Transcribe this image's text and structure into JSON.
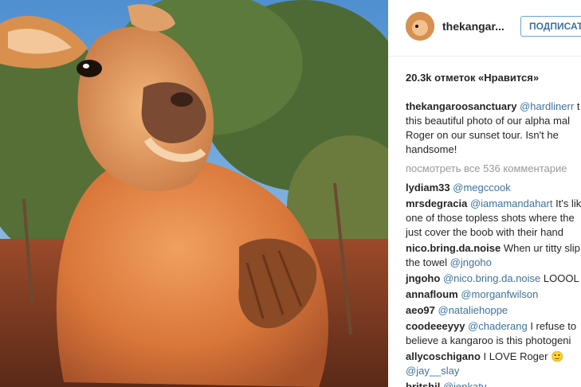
{
  "post": {
    "username": "thekangar...",
    "follow_label": "ПОДПИСАТЬСЯ",
    "likes_text": "20.3k отметок «Нравится»",
    "caption": {
      "user": "thekangaroosanctuary",
      "mention": "@hardlinerr",
      "lines": [
        "t",
        "this beautiful photo of our alpha mal",
        "Roger on our sunset tour. Isn't he",
        "handsome!"
      ]
    },
    "view_all": "посмотреть все 536 комментарие",
    "comments": [
      {
        "user": "lydiam33",
        "mention": "@megccook",
        "text": "",
        "lines": []
      },
      {
        "user": "mrsdegracia",
        "mention": "@iamamandahart",
        "text": "It's lik",
        "lines": [
          "one of those topless shots where the",
          "just cover the boob with their hand"
        ]
      },
      {
        "user": "nico.bring.da.noise",
        "mention": "",
        "text": "When ur titty slip",
        "lines": [],
        "line2_mention": "@jngoho",
        "line2_prefix": "the towel "
      },
      {
        "user": "jngoho",
        "mention": "@nico.bring.da.noise",
        "text": "LOOOL",
        "lines": []
      },
      {
        "user": "annafloum",
        "mention": "@morganfwilson",
        "text": "",
        "lines": []
      },
      {
        "user": "aeo97",
        "mention": "@nataliehoppe",
        "text": "",
        "lines": []
      },
      {
        "user": "coodeeeyyy",
        "mention": "@chaderang",
        "text": "I refuse to",
        "lines": [
          "believe a kangaroo is this photogeni"
        ]
      },
      {
        "user": "allycoschigano",
        "mention": "",
        "text": "I LOVE Roger 🙂",
        "lines": [],
        "line2_mention": "@jay__slay",
        "line2_prefix": ""
      },
      {
        "user": "britshil",
        "mention": "@jenkaty",
        "text": "",
        "lines": []
      }
    ]
  },
  "colors": {
    "link": "#3f729b",
    "text": "#262626",
    "muted": "#999999",
    "follow_border": "#6fa1d6"
  }
}
